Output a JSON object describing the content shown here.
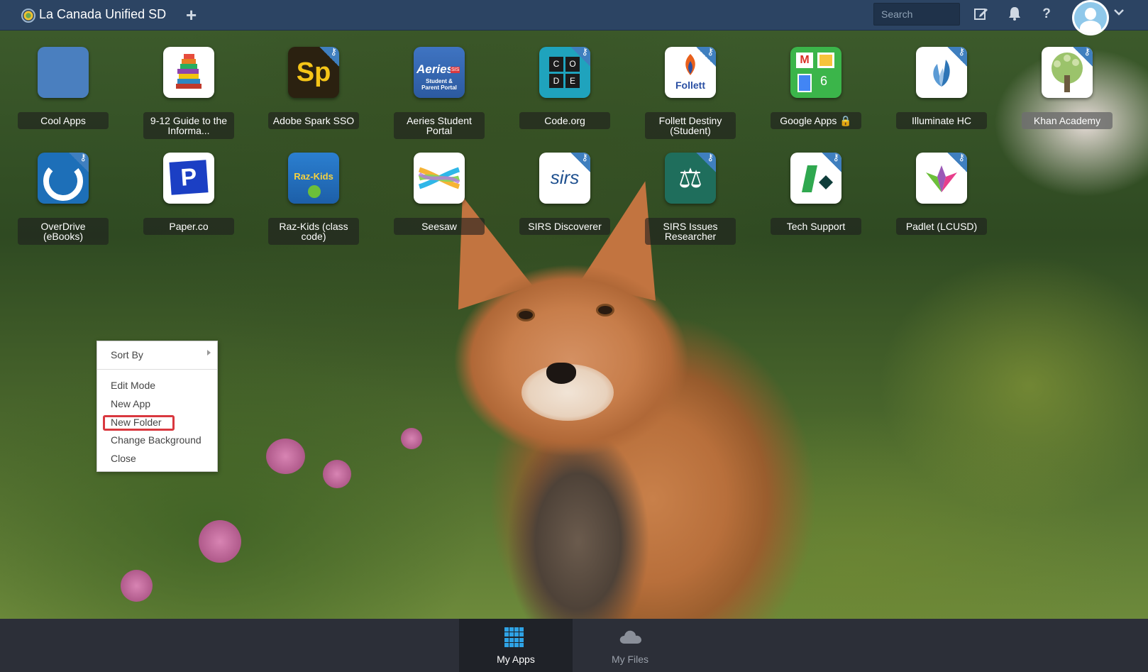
{
  "header": {
    "org_name": "La Canada Unified SD",
    "add_label": "+",
    "search_placeholder": "Search"
  },
  "apps": [
    {
      "label": "Cool Apps",
      "icon": "folder-icon",
      "type": "folder"
    },
    {
      "label": "9-12 Guide to the Informa...",
      "icon": "books-icon"
    },
    {
      "label": "Adobe Spark SSO",
      "icon": "adobe-spark-icon",
      "icon_text": "Sp"
    },
    {
      "label": "Aeries Student Portal",
      "icon": "aeries-icon",
      "icon_text": "Aeries",
      "icon_sub": "Student & Parent Portal",
      "icon_badge": "SIS"
    },
    {
      "label": "Code.org",
      "icon": "code-org-icon",
      "icon_text": [
        "C",
        "O",
        "D",
        "E"
      ]
    },
    {
      "label": "Follett Destiny (Student)",
      "icon": "follett-icon",
      "icon_text": "Follett"
    },
    {
      "label": "Google Apps",
      "icon": "google-apps-icon",
      "icon_text": "6",
      "locked": true
    },
    {
      "label": "Illuminate HC",
      "icon": "illuminate-icon"
    },
    {
      "label": "Khan Academy",
      "icon": "khan-academy-icon"
    },
    {
      "label": "OverDrive (eBooks)",
      "icon": "overdrive-icon"
    },
    {
      "label": "Paper.co",
      "icon": "paper-co-icon",
      "icon_text": "P"
    },
    {
      "label": "Raz-Kids (class code)",
      "icon": "raz-kids-icon",
      "icon_text": "Raz-Kids"
    },
    {
      "label": "Seesaw",
      "icon": "seesaw-icon"
    },
    {
      "label": "SIRS Discoverer",
      "icon": "sirs-icon",
      "icon_text": "sirs"
    },
    {
      "label": "SIRS Issues Researcher",
      "icon": "scales-icon",
      "icon_text": "⚖"
    },
    {
      "label": "Tech Support",
      "icon": "tech-support-icon"
    },
    {
      "label": "Padlet (LCUSD)",
      "icon": "padlet-icon"
    }
  ],
  "context_menu": {
    "sort_by": "Sort By",
    "edit_mode": "Edit Mode",
    "new_app": "New App",
    "new_folder": "New Folder",
    "change_background": "Change Background",
    "close": "Close"
  },
  "bottom_tabs": [
    {
      "label": "My Apps",
      "active": true
    },
    {
      "label": "My Files",
      "active": false
    }
  ],
  "colors": {
    "topbar": "#2c4463",
    "bottombar": "#2c2f38",
    "accent": "#2ea3e6",
    "highlight": "#d9383f"
  }
}
